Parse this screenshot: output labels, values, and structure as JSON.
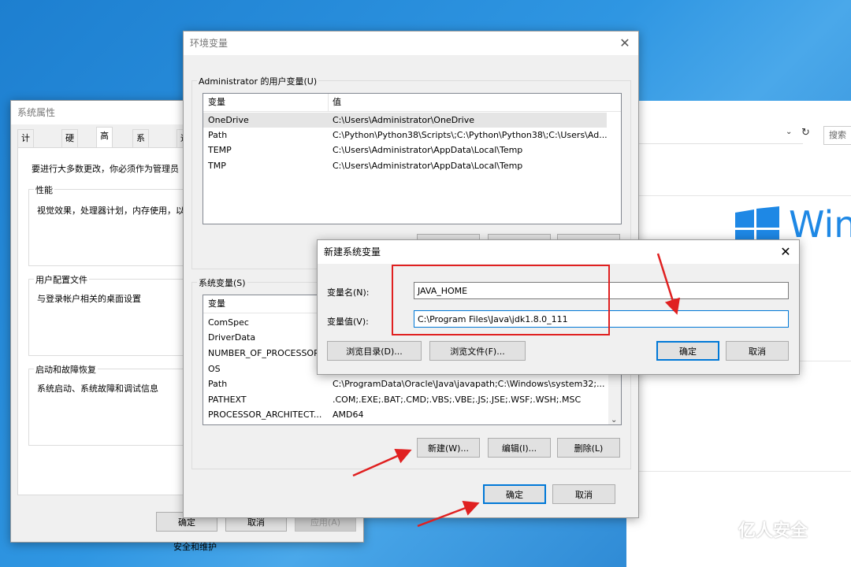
{
  "browser_bg": {
    "refresh_icon": "refresh-icon",
    "dropdown_icon": "chevron-down-icon",
    "search_placeholder": "搜索"
  },
  "sys_props": {
    "title": "系统属性",
    "tabs": [
      "计算机名",
      "硬件",
      "高级",
      "系统保护",
      "远"
    ],
    "admin_note": "要进行大多数更改，你必须作为管理员",
    "perf_label": "性能",
    "perf_text": "视觉效果，处理器计划，内存使用，以",
    "profile_label": "用户配置文件",
    "profile_text": "与登录帐户相关的桌面设置",
    "startup_label": "启动和故障恢复",
    "startup_text": "系统启动、系统故障和调试信息",
    "ok": "确定",
    "cancel": "取消",
    "apply": "应用(A)"
  },
  "security_link": "安全和维护",
  "env": {
    "title": "环境变量",
    "user_group": "Administrator 的用户变量(U)",
    "col_var": "变量",
    "col_val": "值",
    "user_vars": [
      {
        "name": "OneDrive",
        "value": "C:\\Users\\Administrator\\OneDrive"
      },
      {
        "name": "Path",
        "value": "C:\\Python\\Python38\\Scripts\\;C:\\Python\\Python38\\;C:\\Users\\Ad..."
      },
      {
        "name": "TEMP",
        "value": "C:\\Users\\Administrator\\AppData\\Local\\Temp"
      },
      {
        "name": "TMP",
        "value": "C:\\Users\\Administrator\\AppData\\Local\\Temp"
      }
    ],
    "sys_group": "系统变量(S)",
    "sys_vars": [
      {
        "name": "ComSpec",
        "value": ""
      },
      {
        "name": "DriverData",
        "value": ""
      },
      {
        "name": "NUMBER_OF_PROCESSORS",
        "value": ""
      },
      {
        "name": "OS",
        "value": ""
      },
      {
        "name": "Path",
        "value": "C:\\ProgramData\\Oracle\\Java\\javapath;C:\\Windows\\system32;..."
      },
      {
        "name": "PATHEXT",
        "value": ".COM;.EXE;.BAT;.CMD;.VBS;.VBE;.JS;.JSE;.WSF;.WSH;.MSC"
      },
      {
        "name": "PROCESSOR_ARCHITECT...",
        "value": "AMD64"
      }
    ],
    "new_btn": "新建(W)...",
    "edit_btn": "编辑(I)...",
    "delete_btn": "删除(L)",
    "ok": "确定",
    "cancel": "取消"
  },
  "new_var": {
    "title": "新建系统变量",
    "name_label": "变量名(N):",
    "value_label": "变量值(V):",
    "name_value": "JAVA_HOME",
    "value_value": "C:\\Program Files\\Java\\jdk1.8.0_111",
    "browse_dir": "浏览目录(D)...",
    "browse_file": "浏览文件(F)...",
    "ok": "确定",
    "cancel": "取消"
  },
  "windows_logo_text": "Win",
  "watermark": "亿人安全",
  "colors": {
    "annotation_red": "#e02020",
    "accent": "#0078d7"
  }
}
